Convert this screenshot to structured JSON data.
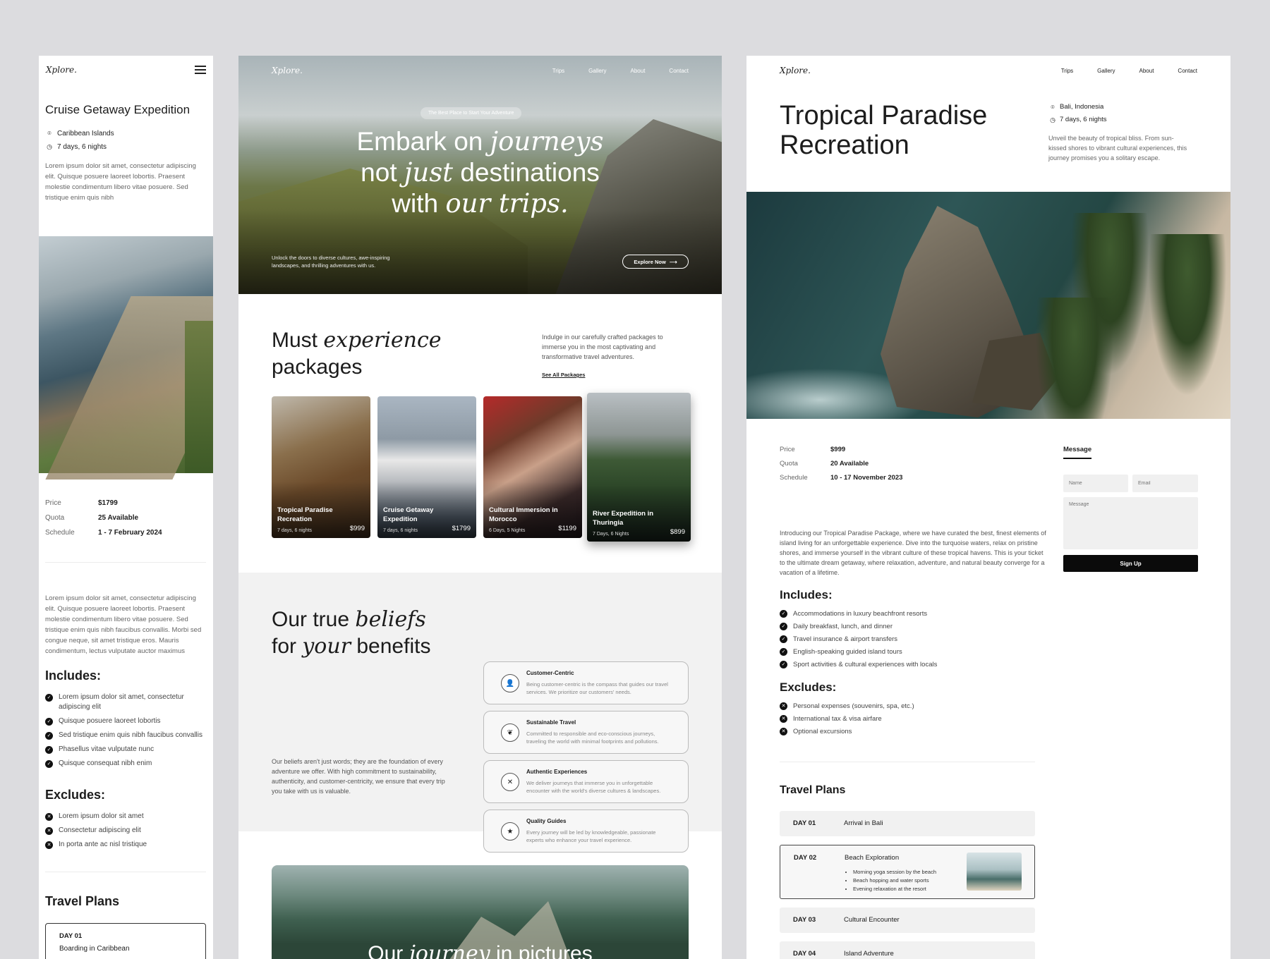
{
  "mobile": {
    "logo": "Xplore.",
    "title": "Cruise Getaway Expedition",
    "location": "Caribbean Islands",
    "duration": "7 days, 6 nights",
    "intro": "Lorem ipsum dolor sit amet, consectetur adipiscing elit. Quisque posuere laoreet lobortis. Praesent molestie condimentum libero vitae posuere. Sed tristique enim quis nibh",
    "specs": [
      {
        "label": "Price",
        "value": "$1799"
      },
      {
        "label": "Quota",
        "value": "25 Available"
      },
      {
        "label": "Schedule",
        "value": "1 - 7 February 2024"
      }
    ],
    "body": "Lorem ipsum dolor sit amet, consectetur adipiscing elit. Quisque posuere laoreet lobortis. Praesent molestie condimentum libero vitae posuere. Sed tristique enim quis nibh faucibus convallis. Morbi sed congue neque, sit amet tristique eros. Mauris condimentum, lectus vulputate auctor maximus",
    "includes_title": "Includes:",
    "includes": [
      "Lorem ipsum dolor sit amet, consectetur adipiscing elit",
      "Quisque posuere laoreet lobortis",
      "Sed tristique enim quis nibh faucibus convallis",
      "Phasellus vitae vulputate nunc",
      "Quisque consequat nibh enim"
    ],
    "excludes_title": "Excludes:",
    "excludes": [
      "Lorem ipsum dolor sit amet",
      "Consectetur adipiscing elit",
      "In porta ante ac nisl tristique"
    ],
    "plans_title": "Travel Plans",
    "day": {
      "label": "DAY 01",
      "title": "Boarding in Caribbean"
    }
  },
  "desktop": {
    "logo": "Xplore.",
    "nav": [
      "Trips",
      "Gallery",
      "About",
      "Contact"
    ],
    "hero": {
      "pill": "The Best Place to Start Your Adventure",
      "line1a": "Embark on ",
      "line1b": "journeys",
      "line2a": "not ",
      "line2b": "just",
      "line2c": " destinations",
      "line3a": "with ",
      "line3b": "our trips.",
      "sub": "Unlock the doors to diverse cultures, awe-inspiring landscapes, and thrilling adventures with us.",
      "cta": "Explore Now",
      "cta_arrow": "⟶"
    },
    "packages": {
      "title_a": "Must ",
      "title_b": "experience",
      "title_c": "packages",
      "desc": "Indulge in our carefully crafted packages to immerse you in the most captivating and transformative travel adventures.",
      "see_all": "See All Packages",
      "cards": [
        {
          "name": "Tropical Paradise Recreation",
          "duration": "7 days, 6 nights",
          "price": "$999"
        },
        {
          "name": "Cruise Getaway Expedition",
          "duration": "7 days, 6 nights",
          "price": "$1799"
        },
        {
          "name": "Cultural Immersion in Morocco",
          "duration": "6 Days, 5 Nights",
          "price": "$1199"
        },
        {
          "name": "River Expedition in Thuringia",
          "duration": "7 Days, 6 Nights",
          "price": "$899"
        }
      ]
    },
    "beliefs": {
      "title_a": "Our true ",
      "title_b": "beliefs",
      "title_c": "for ",
      "title_d": "your",
      "title_e": " benefits",
      "para": "Our beliefs aren't just words; they are the foundation of every adventure we offer. With high commitment to sustainability, authenticity, and customer-centricity, we ensure that every trip you take with us is valuable.",
      "items": [
        {
          "title": "Customer-Centric",
          "desc": "Being customer-centric is the compass that guides our travel services. We prioritize our customers' needs.",
          "icon": "person-icon"
        },
        {
          "title": "Sustainable Travel",
          "desc": "Committed to responsible and eco-conscious journeys, traveling the world with minimal footprints and pollutions.",
          "icon": "leaf-icon"
        },
        {
          "title": "Authentic Experiences",
          "desc": "We deliver journeys that immerse you in unforgettable encounter with the world's diverse cultures & landscapes.",
          "icon": "compass-icon"
        },
        {
          "title": "Quality Guides",
          "desc": "Every journey will be led by knowledgeable, passionate experts who enhance your travel experience.",
          "icon": "star-icon"
        }
      ]
    },
    "gallery": {
      "title_a": "Our ",
      "title_b": "journey",
      "title_c": " in pictures"
    }
  },
  "detail": {
    "logo": "Xplore.",
    "nav": [
      "Trips",
      "Gallery",
      "About",
      "Contact"
    ],
    "title": "Tropical Paradise Recreation",
    "location": "Bali, Indonesia",
    "duration": "7 days, 6 nights",
    "intro": "Unveil the beauty of tropical bliss. From sun-kissed shores to vibrant cultural experiences, this journey promises you a solitary escape.",
    "specs": [
      {
        "label": "Price",
        "value": "$999"
      },
      {
        "label": "Quota",
        "value": "20 Available"
      },
      {
        "label": "Schedule",
        "value": "10 - 17 November 2023"
      }
    ],
    "body": "Introducing our Tropical Paradise Package, where we have curated the best, finest elements of island living for an unforgettable experience. Dive into the turquoise waters, relax on pristine shores, and immerse yourself in the vibrant culture of these tropical havens. This is your ticket to the ultimate dream getaway, where relaxation, adventure, and natural beauty converge for a vacation of a lifetime.",
    "includes_title": "Includes:",
    "includes": [
      "Accommodations in luxury beachfront resorts",
      "Daily breakfast, lunch, and dinner",
      "Travel insurance & airport transfers",
      "English-speaking guided island tours",
      "Sport activities & cultural experiences with locals"
    ],
    "excludes_title": "Excludes:",
    "excludes": [
      "Personal expenses (souvenirs, spa, etc.)",
      "International tax & visa airfare",
      "Optional excursions"
    ],
    "plans_title": "Travel Plans",
    "days": [
      {
        "label": "DAY 01",
        "title": "Arrival in Bali"
      },
      {
        "label": "DAY 02",
        "title": "Beach Exploration",
        "items": [
          "Morning yoga session by the beach",
          "Beach hopping and water sports",
          "Evening relaxation at the resort"
        ]
      },
      {
        "label": "DAY 03",
        "title": "Cultural Encounter"
      },
      {
        "label": "DAY 04",
        "title": "Island Adventure"
      }
    ],
    "form": {
      "tab": "Message",
      "name_placeholder": "Name",
      "email_placeholder": "Email",
      "message_placeholder": "Message",
      "submit": "Sign Up"
    }
  }
}
